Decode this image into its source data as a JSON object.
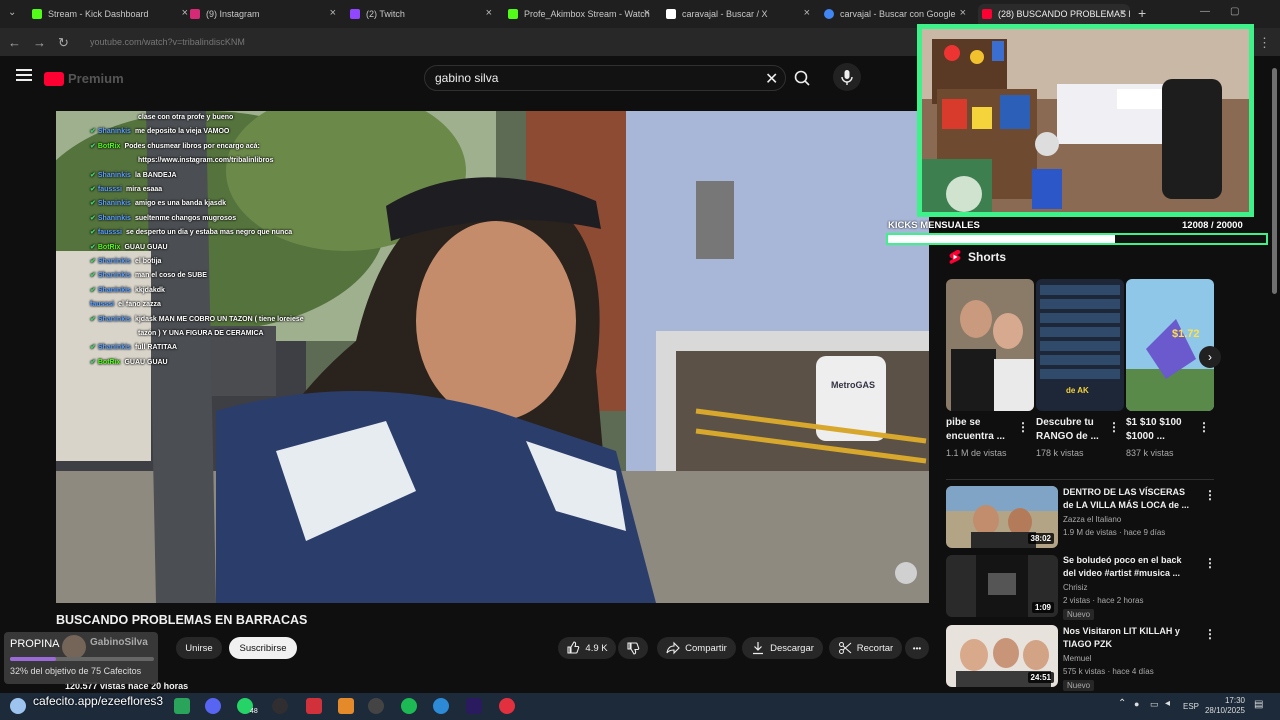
{
  "browser": {
    "tabs": [
      {
        "title": "Stream - Kick Dashboard",
        "color": "#53fc18",
        "active": false
      },
      {
        "title": "(9) Instagram",
        "color": "#d62976",
        "active": false
      },
      {
        "title": "(2) Twitch",
        "color": "#9146ff",
        "active": false
      },
      {
        "title": "Profe_Akimbox Stream - Watch",
        "color": "#53fc18",
        "active": false
      },
      {
        "title": "caravajal - Buscar / X",
        "color": "#ffffff",
        "active": false
      },
      {
        "title": "carvajal - Buscar con Google",
        "color": "#4285f4",
        "active": false
      },
      {
        "title": "(28) BUSCANDO PROBLEMAS E",
        "color": "#ff0033",
        "active": true
      }
    ],
    "new_tab": "+",
    "address": "youtube.com/watch?v=tribalindiscKNM"
  },
  "youtube": {
    "logo_text": "Premium",
    "search_value": "gabino silva"
  },
  "chat": [
    {
      "user": "",
      "message": "clase con otra profe y bueno",
      "bot": false,
      "check": false
    },
    {
      "user": "Shaninkis",
      "message": "me deposito la vieja VAMOO",
      "bot": false,
      "check": true
    },
    {
      "user": "BotRix",
      "message": "Podes chusmear libros por encargo acá:",
      "bot": true,
      "check": true
    },
    {
      "user": "",
      "message": "https://www.instagram.com/tribalinlibros",
      "bot": false,
      "check": false
    },
    {
      "user": "Shaninkis",
      "message": "la BANDEJA",
      "bot": false,
      "check": true
    },
    {
      "user": "fausssi",
      "message": "mira esaaa",
      "bot": false,
      "check": true
    },
    {
      "user": "Shaninkis",
      "message": "amigo es una banda kjasdk",
      "bot": false,
      "check": true
    },
    {
      "user": "Shaninkis",
      "message": "sueltenme changos mugrosos",
      "bot": false,
      "check": true
    },
    {
      "user": "fausssi",
      "message": "se desperto un dia y estaba mas negro que nunca",
      "bot": false,
      "check": true
    },
    {
      "user": "BotRix",
      "message": "GUAU GUAU",
      "bot": true,
      "check": true
    },
    {
      "user": "Shaninkis",
      "message": "el botija",
      "bot": false,
      "check": true
    },
    {
      "user": "Shaninkis",
      "message": "man el coso de SUBE",
      "bot": false,
      "check": true
    },
    {
      "user": "Shaninkis",
      "message": "kkjdakdk",
      "bot": false,
      "check": true
    },
    {
      "user": "fausssi",
      "message": "el fano zazza",
      "bot": false,
      "check": false
    },
    {
      "user": "Shaninkis",
      "message": "kjdask MAN ME COBRO UN TAZON ( tiene loreiese",
      "bot": false,
      "check": true
    },
    {
      "user": "",
      "message": "tazón ) Y UNA FIGURA DE CERAMICA",
      "bot": false,
      "check": false
    },
    {
      "user": "Shaninkis",
      "message": "full RATITAA",
      "bot": false,
      "check": true
    },
    {
      "user": "BotRix",
      "message": "GUAU GUAU",
      "bot": true,
      "check": true
    }
  ],
  "video": {
    "title": "BUSCANDO PROBLEMAS EN BARRACAS",
    "views": "120.577 vistas  hace 20 horas",
    "channel": "GabinoSilva",
    "join_label": "Unirse",
    "subscribe_label": "Suscribirse",
    "likes": "4.9 K",
    "share_label": "Compartir",
    "download_label": "Descargar",
    "clip_label": "Recortar",
    "more_label": "•••"
  },
  "propina": {
    "label": "PROPINA",
    "goal_text": "32% del objetivo de 75 Cafecitos",
    "progress": 0.32
  },
  "kicks": {
    "label": "KICKS MENSUALES",
    "count": "12008  / 20000",
    "current": 12008,
    "goal": 20000
  },
  "shorts": {
    "header": "Shorts",
    "items": [
      {
        "title": "pibe se encuentra ...",
        "views": "1.1 M de vistas"
      },
      {
        "title": "Descubre tu RANGO de ...",
        "views": "178 k vistas"
      },
      {
        "title": "$1 $10 $100 $1000 ...",
        "views": "837 k vistas"
      }
    ],
    "short2_overlay": "de AK",
    "short3_overlay": "$1.72"
  },
  "related": [
    {
      "title": "DENTRO DE LAS VÍSCERAS de LA VILLA MÁS LOCA de ...",
      "channel": "Zazza el Italiano",
      "meta": "1.9 M de vistas · hace 9 días",
      "duration": "38:02",
      "badge": ""
    },
    {
      "title": "Se boludeó poco en el back del video #artist #musica ...",
      "channel": "Chrisiz",
      "meta": "2 vistas · hace 2 horas",
      "duration": "1:09",
      "badge": "Nuevo"
    },
    {
      "title": "Nos Visitaron LIT KILLAH y TIAGO PZK",
      "channel": "Memuel",
      "meta": "575 k vistas · hace 4 días",
      "duration": "24:51",
      "badge": "Nuevo"
    }
  ],
  "taskbar": {
    "url_overlay": "cafecito.app/ezeeflores3",
    "badge_count": "48",
    "lang": "ESP",
    "time": "17:30",
    "date": "28/10/2025"
  },
  "icons": [
    "search-icon",
    "mic-icon",
    "clear-icon",
    "menu-icon",
    "like-icon",
    "dislike-icon",
    "share-icon",
    "download-icon",
    "scissors-icon",
    "shorts-icon",
    "chevron-right-icon",
    "kebab-icon"
  ]
}
